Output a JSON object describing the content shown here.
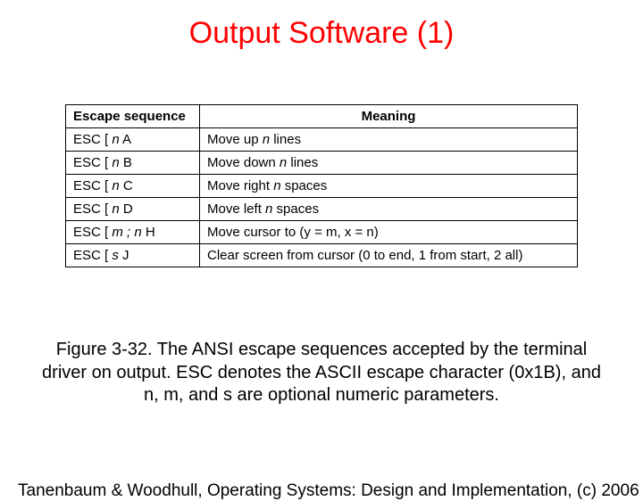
{
  "title": "Output Software (1)",
  "table": {
    "headers": {
      "seq": "Escape sequence",
      "meaning": "Meaning"
    },
    "rows": [
      {
        "seq_pre": "ESC [ ",
        "seq_var": "n",
        "seq_post": " A",
        "meaning_pre": "Move up ",
        "meaning_var": "n",
        "meaning_post": " lines"
      },
      {
        "seq_pre": "ESC [ ",
        "seq_var": "n",
        "seq_post": " B",
        "meaning_pre": "Move down ",
        "meaning_var": "n",
        "meaning_post": " lines"
      },
      {
        "seq_pre": "ESC [ ",
        "seq_var": "n",
        "seq_post": " C",
        "meaning_pre": "Move right ",
        "meaning_var": "n",
        "meaning_post": " spaces"
      },
      {
        "seq_pre": "ESC [ ",
        "seq_var": "n",
        "seq_post": " D",
        "meaning_pre": "Move left ",
        "meaning_var": "n",
        "meaning_post": " spaces"
      },
      {
        "seq_pre": "ESC [ ",
        "seq_var": "m ; n",
        "seq_post": " H",
        "meaning_pre": "Move cursor to (y = m, x = n)",
        "meaning_var": "",
        "meaning_post": ""
      },
      {
        "seq_pre": "ESC [ ",
        "seq_var": "s",
        "seq_post": " J",
        "meaning_pre": "Clear screen from cursor (0 to end, 1 from start, 2 all)",
        "meaning_var": "",
        "meaning_post": ""
      }
    ]
  },
  "caption": "Figure 3-32. The ANSI escape sequences accepted by the terminal driver on output. ESC denotes the ASCII escape character (0x1B), and n, m, and s are optional numeric parameters.",
  "footer": "Tanenbaum & Woodhull, Operating Systems: Design and Implementation, (c) 2006"
}
